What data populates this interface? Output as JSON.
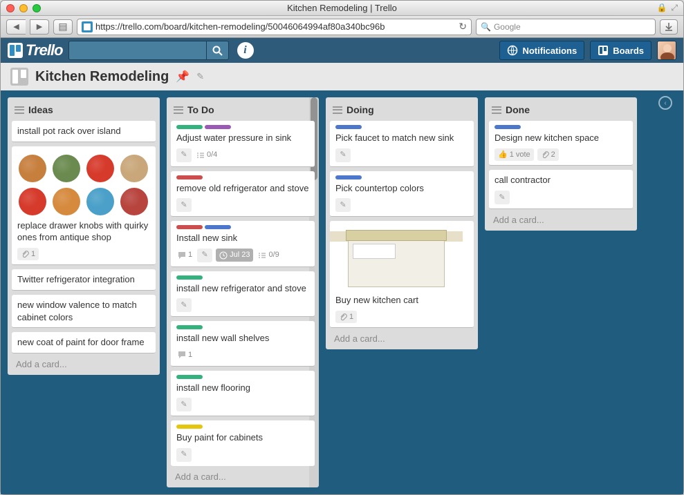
{
  "window": {
    "title": "Kitchen Remodeling | Trello"
  },
  "browser": {
    "url": "https://trello.com/board/kitchen-remodeling/50046064994af80a340bc96b",
    "search_placeholder": "Google"
  },
  "header": {
    "notifications": "Notifications",
    "boards": "Boards"
  },
  "board": {
    "title": "Kitchen Remodeling"
  },
  "lists": [
    {
      "name": "Ideas",
      "add": "Add a card...",
      "cards": [
        {
          "title": "install pot rack over island"
        },
        {
          "title": "replace drawer knobs with quirky ones from antique shop",
          "image": "knobs",
          "attachments": "1"
        },
        {
          "title": "Twitter refrigerator integration"
        },
        {
          "title": "new window valence to match cabinet colors"
        },
        {
          "title": "new coat of paint for door frame"
        }
      ]
    },
    {
      "name": "To Do",
      "add": "Add a card...",
      "cards": [
        {
          "title": "Adjust water pressure in sink",
          "labels": [
            "green",
            "purple"
          ],
          "pencil": true,
          "checklist": "0/4"
        },
        {
          "title": "remove old refrigerator and stove",
          "labels": [
            "red"
          ],
          "pencil": true
        },
        {
          "title": "Install new sink",
          "labels": [
            "red",
            "blue"
          ],
          "comments": "1",
          "pencil": true,
          "date": "Jul 23",
          "checklist": "0/9"
        },
        {
          "title": "install new refrigerator and stove",
          "labels": [
            "green"
          ],
          "pencil": true
        },
        {
          "title": "install new wall shelves",
          "labels": [
            "green"
          ],
          "comments": "1"
        },
        {
          "title": "install new flooring",
          "labels": [
            "green"
          ],
          "pencil": true
        },
        {
          "title": "Buy paint for cabinets",
          "labels": [
            "yellow"
          ],
          "pencil": true
        }
      ]
    },
    {
      "name": "Doing",
      "add": "Add a card...",
      "cards": [
        {
          "title": "Pick faucet to match new sink",
          "labels": [
            "blue"
          ],
          "pencil": true
        },
        {
          "title": "Pick countertop colors",
          "labels": [
            "blue"
          ],
          "pencil": true
        },
        {
          "title": "Buy new kitchen cart",
          "image": "cart",
          "attachments": "1"
        }
      ]
    },
    {
      "name": "Done",
      "add": "Add a card...",
      "cards": [
        {
          "title": "Design new kitchen space",
          "labels": [
            "blue"
          ],
          "votes": "1 vote",
          "attachments": "2"
        },
        {
          "title": "call contractor",
          "pencil": true
        }
      ]
    }
  ]
}
